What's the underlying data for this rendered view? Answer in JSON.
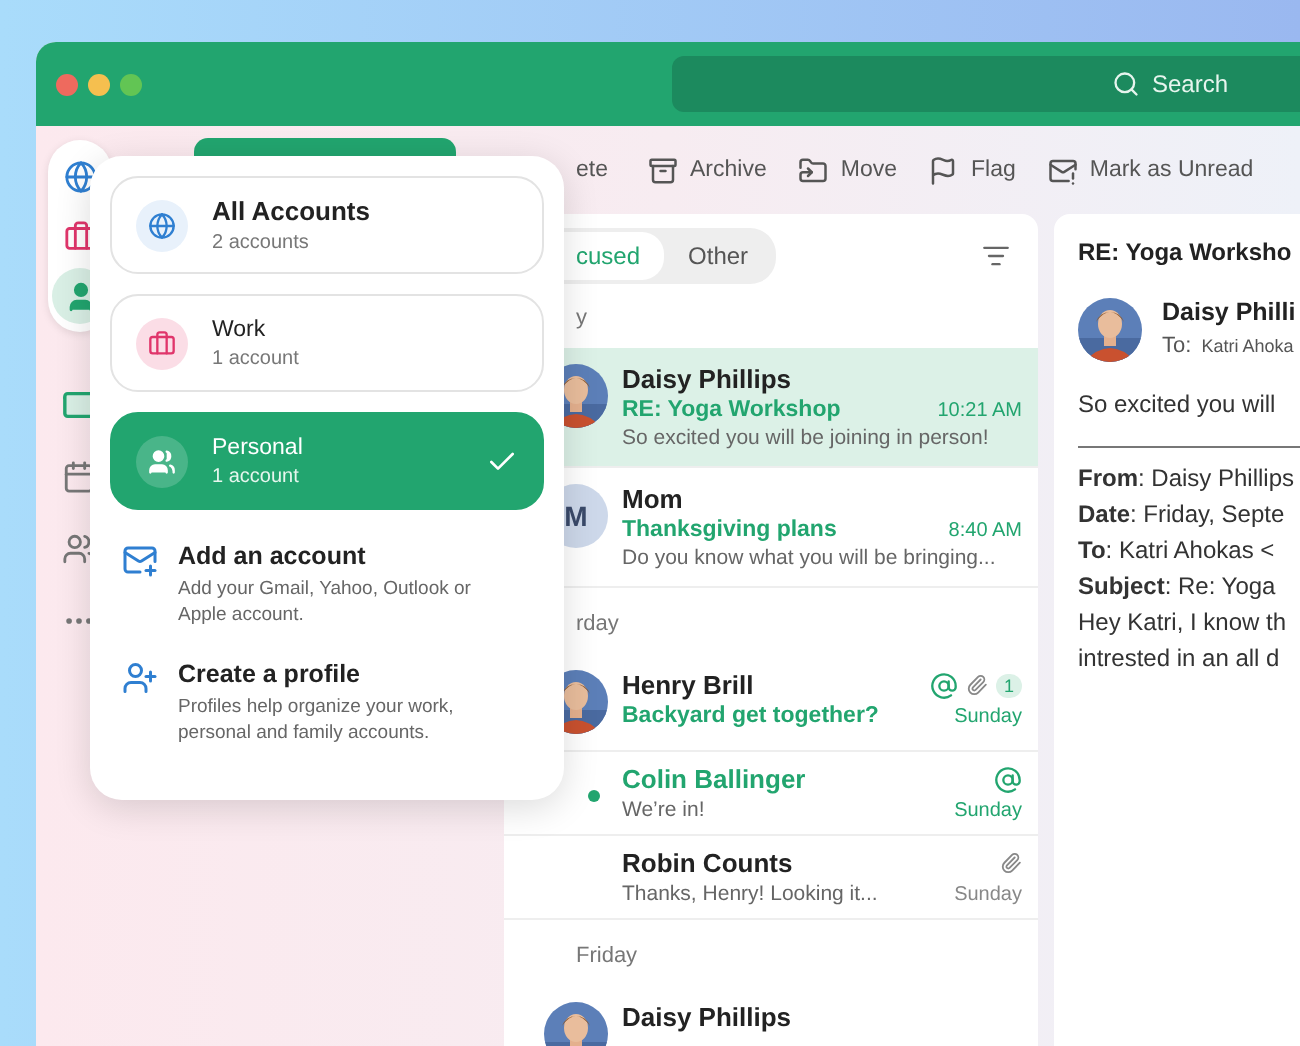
{
  "window": {
    "search": {
      "placeholder": "Search"
    }
  },
  "rail": {
    "profiles": [
      {
        "kind": "all",
        "selected": false
      },
      {
        "kind": "work",
        "selected": false
      },
      {
        "kind": "personal",
        "selected": true
      }
    ],
    "nav": [
      {
        "kind": "mail",
        "selected": true
      },
      {
        "kind": "calendar",
        "selected": false
      },
      {
        "kind": "people",
        "selected": false
      },
      {
        "kind": "more",
        "selected": false
      }
    ]
  },
  "toolbar": [
    {
      "kind": "delete",
      "label": "ete"
    },
    {
      "kind": "archive",
      "label": "Archive"
    },
    {
      "kind": "move",
      "label": "Move"
    },
    {
      "kind": "flag",
      "label": "Flag"
    },
    {
      "kind": "unread",
      "label": "Mark as Unread"
    }
  ],
  "popover": {
    "accounts": [
      {
        "kind": "all",
        "title": "All Accounts",
        "subtitle": "2 accounts",
        "selected": false
      },
      {
        "kind": "work",
        "title": "Work",
        "subtitle": "1 account",
        "selected": false
      },
      {
        "kind": "personal",
        "title": "Personal",
        "subtitle": "1 account",
        "selected": true
      }
    ],
    "actions": [
      {
        "kind": "add-account",
        "title": "Add an account",
        "description": "Add your Gmail, Yahoo, Outlook or Apple account."
      },
      {
        "kind": "create-profile",
        "title": "Create a profile",
        "description": "Profiles help organize your work, personal and family accounts."
      }
    ]
  },
  "list": {
    "tabs": [
      {
        "label": "cused",
        "selected": true
      },
      {
        "label": "Other",
        "selected": false
      }
    ],
    "groups": [
      {
        "label": "y",
        "messages": [
          {
            "sender": "Daisy Phillips",
            "subject": "RE: Yoga Workshop",
            "time": "10:21 AM",
            "preview": "So excited you will be joining in person!",
            "selected": true,
            "unread": false
          },
          {
            "avatar": {
              "kind": "initial",
              "text": "M"
            },
            "sender": "Mom",
            "subject": "Thanksgiving plans",
            "time": "8:40 AM",
            "preview": "Do you know what you will be bringing...",
            "selected": false,
            "unread": false
          }
        ]
      },
      {
        "label": "rday",
        "messages": [
          {
            "sender": "Henry Brill",
            "subject": "Backyard get together?",
            "time": "Sunday",
            "selected": false,
            "unread": false,
            "mention": true,
            "attachment": true,
            "count": "1"
          },
          {
            "sender": "Colin Ballinger",
            "preview": "We’re in!",
            "time": "Sunday",
            "selected": false,
            "unread": true,
            "mention": true
          },
          {
            "sender": "Robin Counts",
            "preview": "Thanks, Henry! Looking it...",
            "time": "Sunday",
            "selected": false,
            "unread": false,
            "attachment": true
          }
        ]
      },
      {
        "label": "Friday",
        "messages": [
          {
            "sender": "Daisy Phillips",
            "selected": false,
            "unread": false
          }
        ]
      }
    ]
  },
  "reading": {
    "subject": "RE: Yoga Worksho",
    "sender": "Daisy Philli",
    "to_label": "To:",
    "to": "Katri Ahoka",
    "body": "So excited you will",
    "quote": [
      "**From**: Daisy Phillips",
      "**Date**: Friday, Septe",
      "**To**: Katri Ahokas <",
      "**Subject**: Re: Yoga",
      "Hey Katri, I know th",
      "intrested in an all d"
    ]
  }
}
